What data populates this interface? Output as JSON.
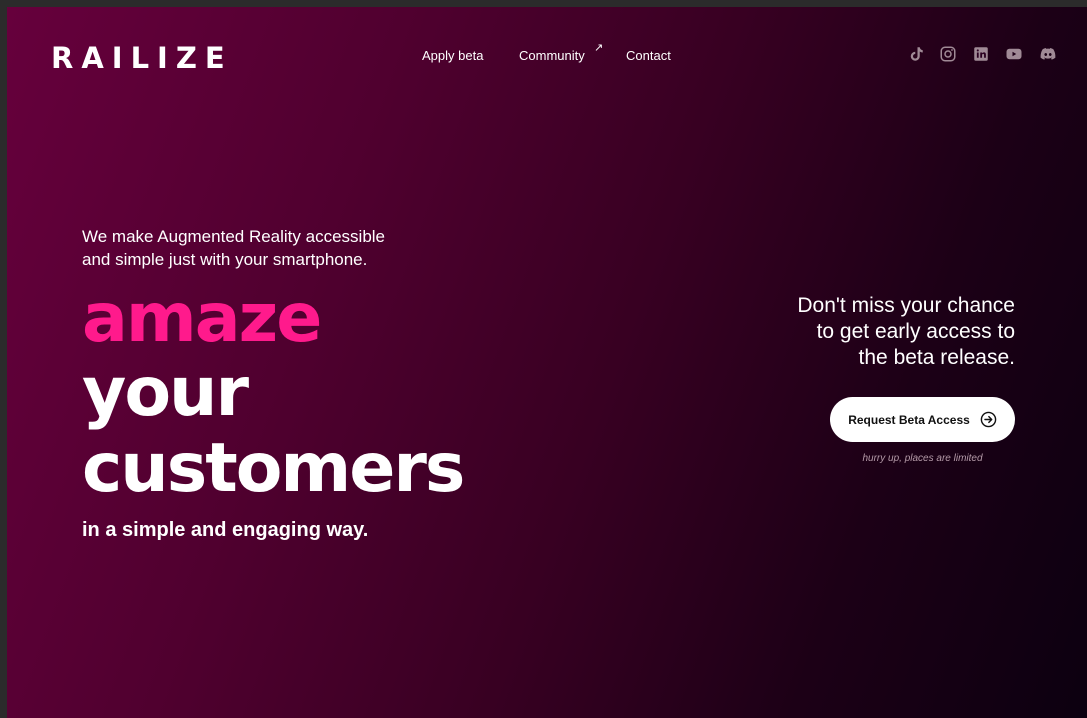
{
  "brand": {
    "logo": "RAILIZE"
  },
  "nav": {
    "items": [
      {
        "label": "Apply beta"
      },
      {
        "label": "Community",
        "external_icon": "arrow-up-right-icon"
      },
      {
        "label": "Contact"
      }
    ]
  },
  "social": {
    "icons": [
      "tiktok-icon",
      "instagram-icon",
      "linkedin-icon",
      "youtube-icon",
      "discord-icon"
    ]
  },
  "hero": {
    "tagline_line1": "We make Augmented Reality accessible",
    "tagline_line2": "and simple just with your smartphone.",
    "headline_accent": "amaze",
    "headline_line2": "your",
    "headline_line3": "customers",
    "subline": "in a simple and engaging way."
  },
  "cta": {
    "pitch_line1": "Don't miss your chance",
    "pitch_line2": "to get early access to",
    "pitch_line3": "the beta release.",
    "button_label": "Request Beta Access",
    "button_icon": "arrow-right-circle-icon",
    "hint": "hurry up, places are limited"
  },
  "colors": {
    "accent": "#ff1a8c",
    "bg_start": "#66003c",
    "bg_end": "#0c0010",
    "icon_muted": "#a08a96"
  }
}
